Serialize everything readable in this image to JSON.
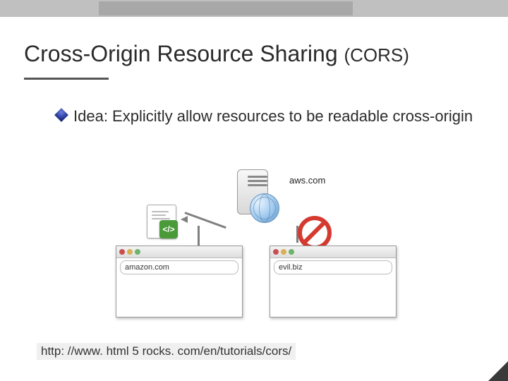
{
  "title": {
    "main": "Cross-Origin Resource Sharing ",
    "paren": "(CORS)"
  },
  "bullet": "Idea: Explicitly allow resources to be readable cross-origin",
  "diagram": {
    "server_label": "aws.com",
    "code_badge": "</>",
    "browser_left": "amazon.com",
    "browser_right": "evil.biz"
  },
  "footer_url": "http: //www. html 5 rocks. com/en/tutorials/cors/"
}
